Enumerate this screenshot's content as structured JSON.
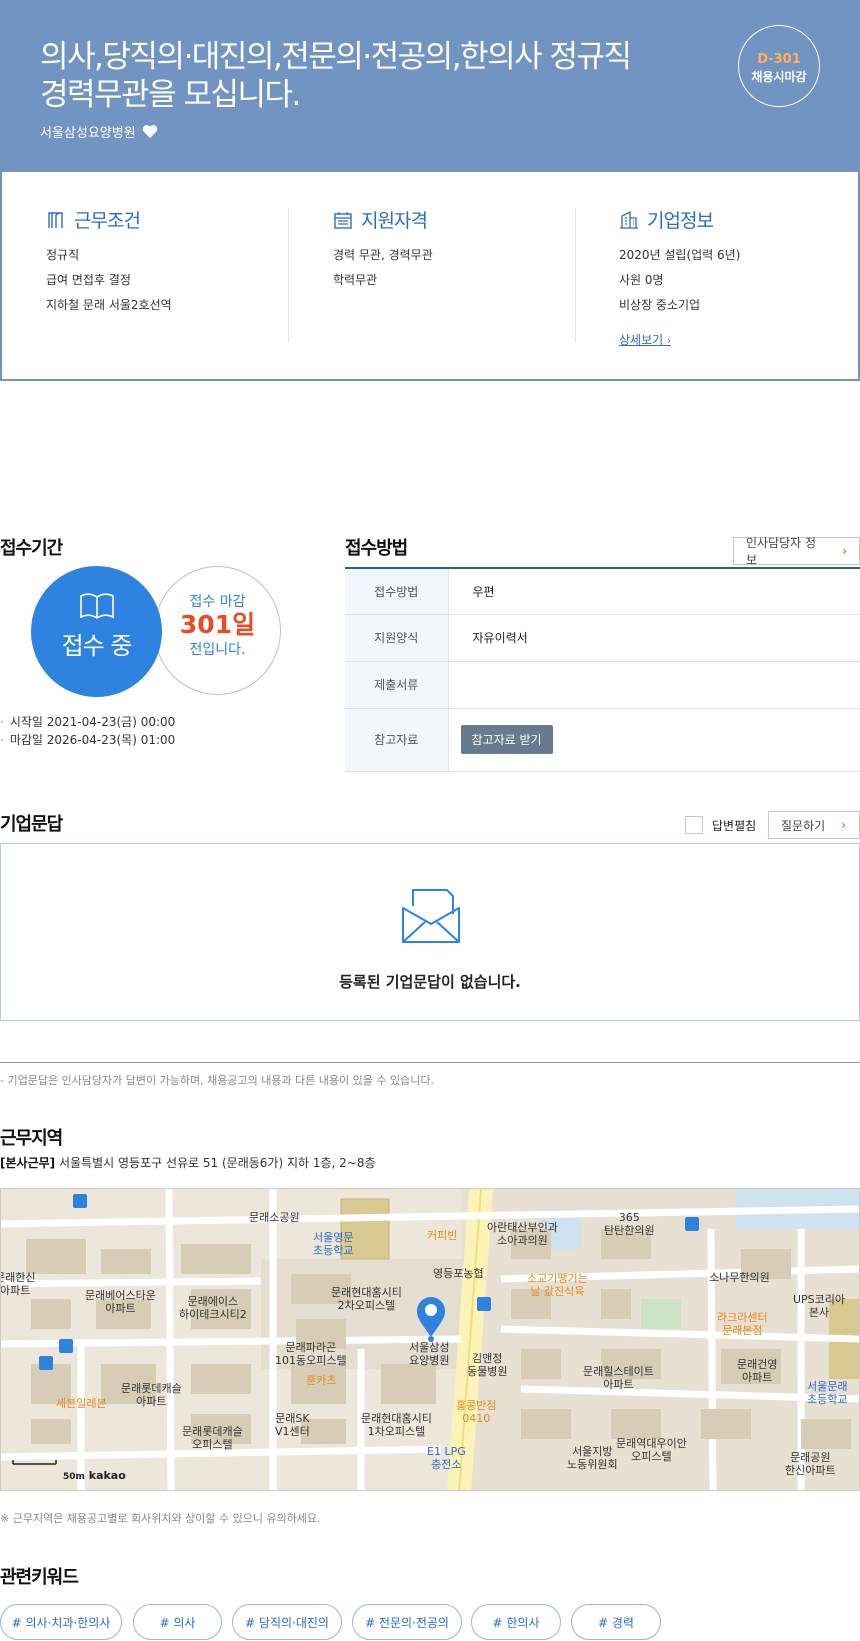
{
  "hero": {
    "title_line1": "의사,당직의·대진의,전문의·전공의,한의사 정규직",
    "title_line2": "경력무관을 모십니다.",
    "company": "서울삼성요양병원",
    "dday": "D-301",
    "deadline": "채용시마감"
  },
  "summary": {
    "work": {
      "title": "근무조건",
      "items": [
        "정규직",
        "급여 면접후 결정",
        "지하철 문래 서울2호선역"
      ]
    },
    "qual": {
      "title": "지원자격",
      "items": [
        "경력 무관, 경력무관",
        "학력무관"
      ]
    },
    "corp": {
      "title": "기업정보",
      "items": [
        "2020년 설립(업력 6년)",
        "사원 0명",
        "비상장 중소기업"
      ],
      "link": "상세보기"
    }
  },
  "period": {
    "title": "접수기간",
    "status": "접수 중",
    "remain_pre": "접수 마감",
    "remain_days": "301일",
    "remain_post": "전입니다.",
    "start": "시작일 2021-04-23(금) 00:00",
    "end": "마감일 2026-04-23(목) 01:00"
  },
  "method": {
    "title": "접수방법",
    "hr_button": "인사담당자 정보",
    "rows": [
      {
        "label": "접수방법",
        "value": "우편"
      },
      {
        "label": "지원양식",
        "value": "자유이력서"
      },
      {
        "label": "제출서류",
        "value": ""
      },
      {
        "label": "참고자료",
        "button": "참고자료 받기"
      }
    ]
  },
  "qa": {
    "title": "기업문답",
    "unfold_label": "답변펼침",
    "ask_button": "질문하기",
    "empty": "등록된 기업문답이 없습니다.",
    "note": "- 기업문답은 인사담당자가 답변이 가능하며, 채용공고의 내용과 다른 내용이 있을 수 있습니다."
  },
  "location": {
    "title": "근무지역",
    "tag": "[본사근무]",
    "address": "서울특별시 영등포구 선유로 51 (문래동6가) 지하 1층, 2~8층",
    "note": "※ 근무지역은 채용공고별로 회사위치와 상이할 수 있으니 유의하세요.",
    "map": {
      "scale": "50m",
      "brand": "kakao",
      "labels": [
        "문래소공원",
        "서울영문\n초등학교",
        "커피빈",
        "아란태산부인과\n소아과의원",
        "365\n탄탄한의원",
        "영등포농협",
        "소교기땡기는\n날 값진식육",
        "문래현대홈시티\n2차오피스텔",
        "소나무한의원",
        "UPS코리아\n본사",
        "라크라센터\n문래본점",
        "문래베어스타운\n아파트",
        "문래에이스\n하이테크시티2",
        "문래파라곤\n101동오피스텔",
        "서울삼성\n요양병원",
        "김앤정\n동물병원",
        "문래힐스테이트\n아파트",
        "문래건영\n아파트",
        "서울문래\n초등학교",
        "문래롯데캐슬\n아파트",
        "훈카츠",
        "세븐일레븐",
        "문래SK\nV1센터",
        "문래현대홈시티\n1차오피스텔",
        "홍콩반점\n0410",
        "문래롯데캐슬\n오피스텔",
        "E1 LPG\n충전소",
        "서울지방\n노동위원회",
        "문래역대우이안\n오피스텔",
        "문래공원\n한신아파트",
        "문래한신\n아파트"
      ]
    }
  },
  "keywords": {
    "title": "관련키워드",
    "items": [
      "# 의사·치과·한의사",
      "# 의사",
      "# 당직의·대진의",
      "# 전문의·전공의",
      "# 한의사",
      "# 경력"
    ]
  }
}
